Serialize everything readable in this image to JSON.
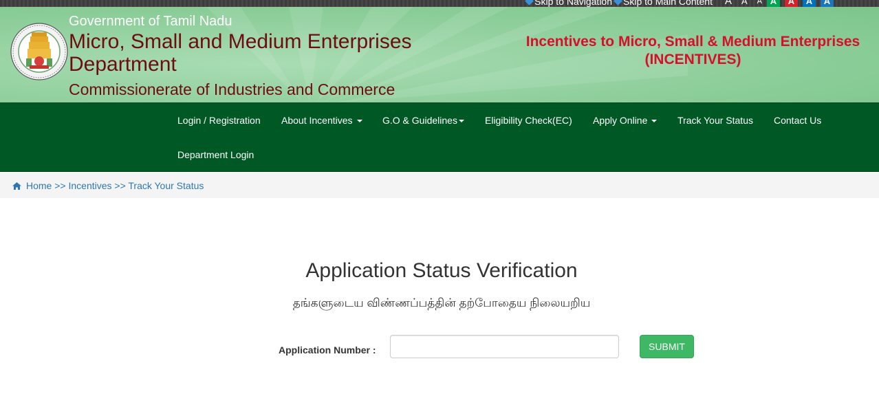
{
  "topbar": {
    "skip_navigation": "Skip to Navigation",
    "skip_main": "Skip to Main Content",
    "font_sizes": [
      "A",
      "A",
      "A"
    ],
    "color_themes": [
      {
        "label": "A",
        "color": "#00a651"
      },
      {
        "label": "A",
        "color": "#d2232a"
      },
      {
        "label": "A",
        "color": "#0072bc"
      },
      {
        "label": "A",
        "color": "#1b75bb"
      }
    ]
  },
  "header": {
    "gov": "Government of Tamil Nadu",
    "dept": "Micro, Small and Medium Enterprises Department",
    "comm": "Commissionerate of Industries and Commerce",
    "right_line1": "Incentives to Micro, Small & Medium Enterprises",
    "right_line2": "(INCENTIVES)",
    "emblem_icon": "tamil-nadu-emblem-icon"
  },
  "nav": {
    "items": [
      {
        "label": "Login / Registration",
        "dropdown": false
      },
      {
        "label": "About Incentives",
        "dropdown": true
      },
      {
        "label": "G.O & Guidelines",
        "dropdown": true
      },
      {
        "label": "Eligibility Check(EC)",
        "dropdown": false
      },
      {
        "label": "Apply Online",
        "dropdown": true
      },
      {
        "label": "Track Your Status",
        "dropdown": false
      },
      {
        "label": "Contact Us",
        "dropdown": false
      },
      {
        "label": "Department Login",
        "dropdown": false
      }
    ]
  },
  "breadcrumb": {
    "icon": "home-icon",
    "text": "Home >> Incentives >> Track Your Status"
  },
  "main": {
    "title": "Application Status Verification",
    "subtitle": "தங்களுடைய விண்ணப்பத்தின் தற்போதைய நிலையறிய",
    "app_label": "Application Number :",
    "app_value": "",
    "submit_label": "SUBMIT"
  },
  "colors": {
    "navbar": "#005825",
    "header_green": "#8fcf9c",
    "dept_text": "#6e0c12",
    "incentives_red": "#d5102a",
    "submit_green": "#3fb865",
    "link_blue": "#2d78b4"
  }
}
